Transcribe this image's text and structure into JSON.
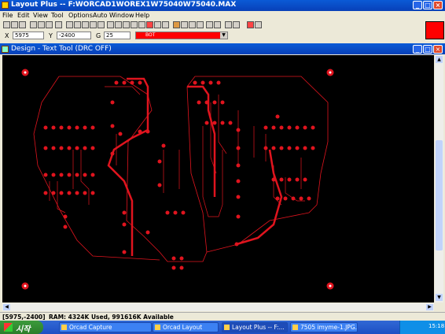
{
  "window": {
    "title": "Layout Plus -- F:WORCAD1WOREX1W75040W75040.MAX",
    "min_icon": "minimize-icon",
    "max_icon": "maximize-icon",
    "close_icon": "close-icon"
  },
  "menu": [
    "File",
    "Edit",
    "View",
    "Tool",
    "Options",
    "Auto",
    "Window",
    "Help"
  ],
  "coords": {
    "x_label": "X",
    "x_value": "5975",
    "y_label": "Y",
    "y_value": "-2400",
    "g_label": "G",
    "g_value": "25",
    "layer": "BOT"
  },
  "design": {
    "title": "Design - Text Tool (DRC OFF)"
  },
  "status": {
    "coords": "[5975,-2400]",
    "ram": "RAM: 4324K Used, 991616K Available"
  },
  "taskbar": {
    "start": "시작",
    "tasks": [
      "Orcad Capture",
      "Orcad Layout",
      "Layout Plus -- F:...",
      "7505 imyme-1.JPG..."
    ],
    "clock": "15:18"
  },
  "colors": {
    "trace": "#e0141e",
    "pcb_background": "#000000",
    "titlebar": "#0a5ad6",
    "outline": "#e0141e"
  }
}
